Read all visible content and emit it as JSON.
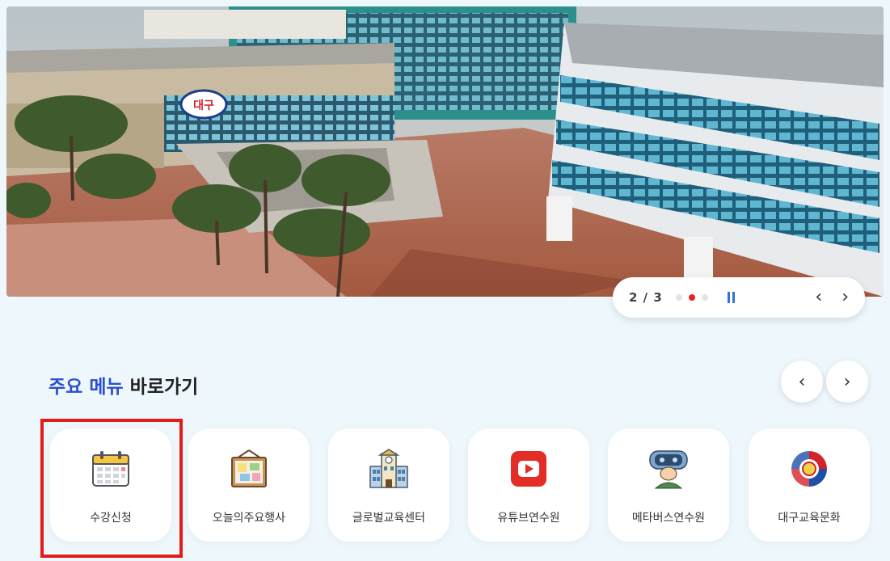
{
  "hero": {
    "building_sign": "대구",
    "counter": "2 / 3",
    "slide_total": 3,
    "active_slide": 2,
    "accent_color": "#e5232b",
    "pause_icon": "pause-icon",
    "prev_arrow": "‹",
    "next_arrow": "›"
  },
  "quick_menu": {
    "title_highlight": "주요 메뉴",
    "title_rest": " 바로가기",
    "highlight_color": "#2a4fd1",
    "prev_arrow": "‹",
    "next_arrow": "›",
    "items": [
      {
        "label": "수강신청",
        "icon": "calendar-icon",
        "selected": true
      },
      {
        "label": "오늘의주요행사",
        "icon": "bulletin-board-icon"
      },
      {
        "label": "글로벌교육센터",
        "icon": "school-building-icon"
      },
      {
        "label": "유튜브연수원",
        "icon": "youtube-icon"
      },
      {
        "label": "메타버스연수원",
        "icon": "vr-headset-icon"
      },
      {
        "label": "대구교육문화",
        "icon": "daegu-emblem-icon"
      }
    ],
    "selection_box_color": "#e31b1b"
  }
}
